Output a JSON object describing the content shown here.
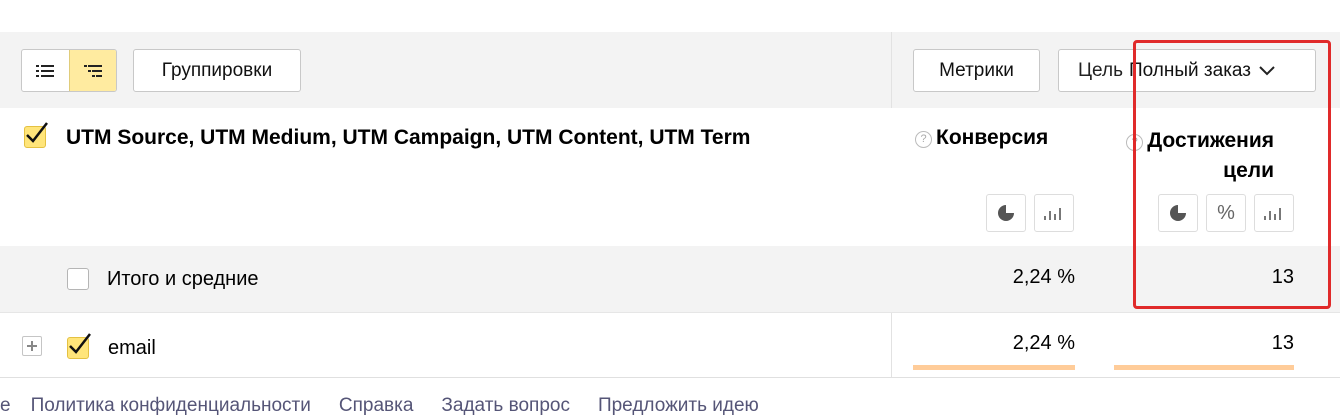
{
  "toolbar": {
    "groupings_label": "Группировки",
    "metrics_label": "Метрики",
    "goal_label": "Цель",
    "goal_selected": "Полный заказ"
  },
  "header": {
    "dimensions": "UTM Source, UTM Medium, UTM Campaign, UTM Content, UTM Term",
    "metric_conversion": "Конверсия",
    "metric_goal_line1": "Достижения",
    "metric_goal_line2": "цели"
  },
  "totals": {
    "label": "Итого и средние",
    "conversion": "2,24 %",
    "goals": "13",
    "conversion_fraction": 1.0,
    "goals_fraction": 1.0
  },
  "rows": [
    {
      "label": "email",
      "conversion": "2,24 %",
      "goals": "13",
      "conversion_fraction": 1.0,
      "goals_fraction": 1.0
    }
  ],
  "footer": {
    "links": [
      "Политика конфиденциальности",
      "Справка",
      "Задать вопрос",
      "Предложить идею"
    ]
  },
  "colors": {
    "accent_yellow": "#ffdb4d",
    "bar_orange": "#ffcc99",
    "highlight_red": "#e02a2a"
  }
}
